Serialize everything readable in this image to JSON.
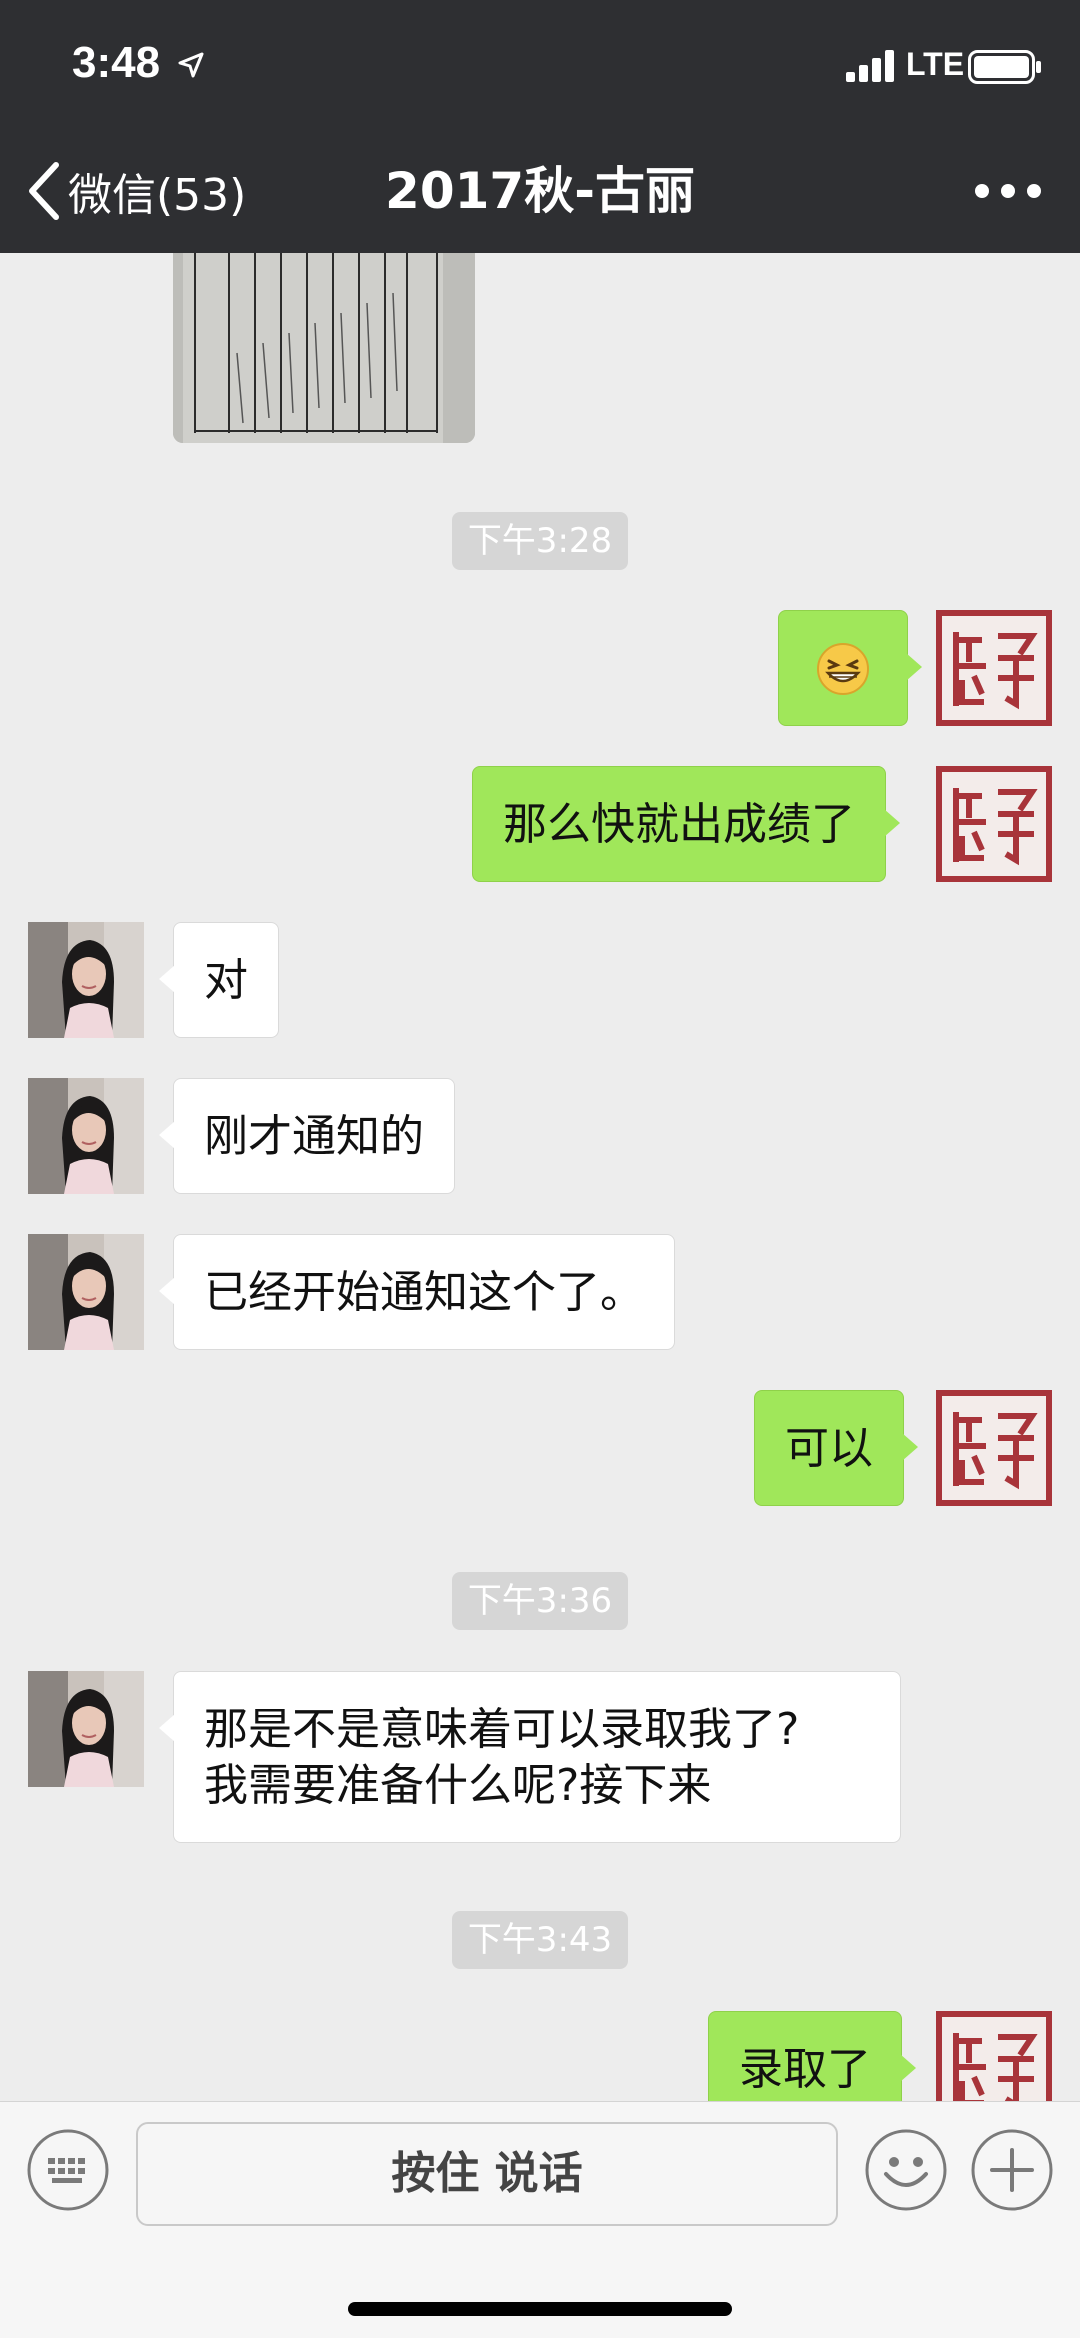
{
  "status_bar": {
    "time": "3:48",
    "network": "LTE",
    "location_icon": "location-arrow-icon",
    "signal_icon": "signal-bars-icon",
    "battery_icon": "battery-icon"
  },
  "nav": {
    "back_label": "微信(53)",
    "title": "2017秋-古丽",
    "back_icon": "chevron-left-icon",
    "more_icon": "more-dots-icon"
  },
  "messages": {
    "ts1": "下午3:28",
    "m1_icon": "grinning-emoji",
    "m2": "那么快就出成绩了",
    "m3": "对",
    "m4": "刚才通知的",
    "m5": "已经开始通知这个了。",
    "m6": "可以",
    "ts2": "下午3:36",
    "m7": " 那是不是意味着可以录取我了?\n我需要准备什么呢?接下来",
    "ts3": "下午3:43",
    "m8": "录取了"
  },
  "input_bar": {
    "hold_to_talk": "按住 说话",
    "keyboard_icon": "keyboard-icon",
    "emoji_icon": "smiley-icon",
    "plus_icon": "plus-icon"
  },
  "colors": {
    "nav_bg": "#2e2f32",
    "chat_bg": "#ededed",
    "sent_bubble": "#a0e75a",
    "received_bubble": "#ffffff",
    "seal_red": "#a8343a"
  }
}
